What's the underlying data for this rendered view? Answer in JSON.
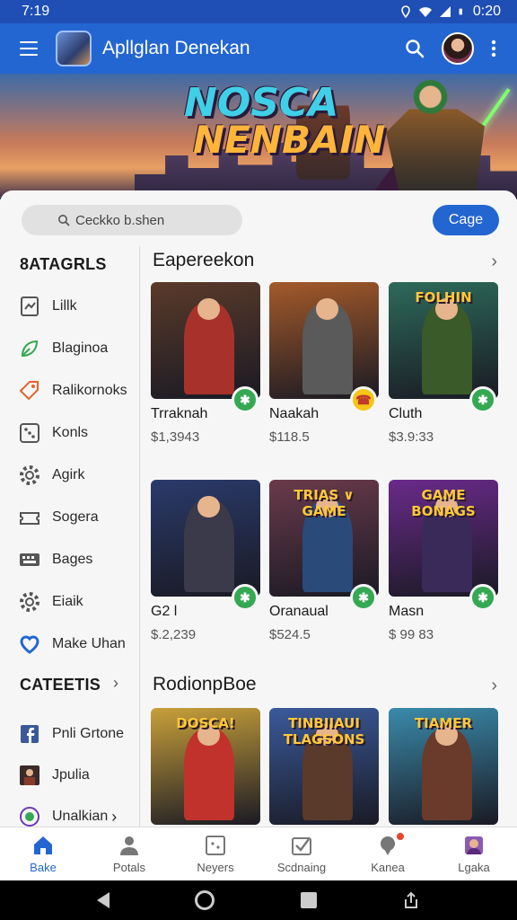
{
  "status_bar": {
    "time": "7:19",
    "clock_right": "0:20",
    "icons": [
      "location-icon",
      "wifi-icon",
      "signal-icon",
      "battery-icon"
    ]
  },
  "app_bar": {
    "title": "Apllglan Denekan",
    "icons": [
      "menu-icon",
      "search-icon",
      "more-vert-icon"
    ]
  },
  "banner": {
    "title_line1": "NOSCA",
    "title_line2": "NENBAIN"
  },
  "search": {
    "placeholder": "Ceckko b.shen",
    "button_label": "Cagе"
  },
  "sidebar": {
    "heading": "8ATAGRLS",
    "items": [
      {
        "label": "Lillk",
        "icon": "chart-doc-icon",
        "color": "#555555"
      },
      {
        "label": "Blaginoa",
        "icon": "leaf-icon",
        "color": "#34a853"
      },
      {
        "label": "Ralikornoks",
        "icon": "tag-icon",
        "color": "#e8632c"
      },
      {
        "label": "Konls",
        "icon": "dice-icon",
        "color": "#555555"
      },
      {
        "label": "Agirk",
        "icon": "gear-icon",
        "color": "#555555"
      },
      {
        "label": "Sogera",
        "icon": "ticket-icon",
        "color": "#555555"
      },
      {
        "label": "Bages",
        "icon": "keyboard-icon",
        "color": "#555555"
      },
      {
        "label": "Eiaik",
        "icon": "gear-icon",
        "color": "#555555"
      },
      {
        "label": "Make Uhan",
        "icon": "heart-icon",
        "color": "#2366d1"
      }
    ],
    "heading2": "CATEETIS",
    "items2": [
      {
        "label": "Pnli Grtone",
        "icon": "facebook-icon",
        "color": "#3b5998"
      },
      {
        "label": "Jpulia",
        "icon": "game-thumb-icon",
        "color": "#8a3a2a"
      },
      {
        "label": "Unalkian",
        "icon": "app-badge-icon",
        "color": "#6a3ab5"
      }
    ]
  },
  "sections": [
    {
      "title": "Eapereekon",
      "cards": [
        {
          "name": "Trraknah",
          "price": "$1,3943",
          "badge": "✱",
          "badge_style": "green",
          "bg": "#5a3a2a",
          "fig": "#a8322b"
        },
        {
          "name": "Naakah",
          "price": "$118.5",
          "badge": "☎",
          "badge_style": "yellow",
          "bg": "#a45a2a",
          "fig": "#5a5a5a"
        },
        {
          "name": "Cluth",
          "price": "$3.9:33",
          "badge": "✱",
          "badge_style": "green",
          "bg": "#2d6a5a",
          "fig": "#3a5a2a",
          "word": "FOLHIN"
        }
      ]
    },
    {
      "cards": [
        {
          "name": "G2 l",
          "price": "$.2,239",
          "badge": "✱",
          "badge_style": "green",
          "bg": "#2a3a6a",
          "fig": "#3a3a4a"
        },
        {
          "name": "Oranaual",
          "price": "$524.5",
          "badge": "✱",
          "badge_style": "green",
          "bg": "#6a3a4a",
          "fig": "#2a4a7a",
          "word": "TRIAS ∨ GAME"
        },
        {
          "name": "Masn",
          "price": "$ 99 83",
          "badge": "✱",
          "badge_style": "green",
          "bg": "#6a2a8a",
          "fig": "#3a2a5a",
          "word": "GAME BONAGS"
        }
      ]
    },
    {
      "title": "RodionpBoe",
      "cards": [
        {
          "bg": "#c8a03a",
          "fig": "#c0322b",
          "word": "DOSCA!"
        },
        {
          "bg": "#3a5a9a",
          "fig": "#5a3a2a",
          "word": "TINBIIAUI TLAGSONS"
        },
        {
          "bg": "#3a8aaa",
          "fig": "#6a3a2a",
          "word": "TIAMER"
        }
      ]
    }
  ],
  "bottom_nav": [
    {
      "label": "Bake",
      "icon": "home-icon",
      "active": true
    },
    {
      "label": "Potals",
      "icon": "person-icon"
    },
    {
      "label": "Neyers",
      "icon": "dice-box-icon"
    },
    {
      "label": "Scdnaing",
      "icon": "check-box-icon"
    },
    {
      "label": "Kanea",
      "icon": "chat-pin-icon",
      "dot": true
    },
    {
      "label": "Lgaka",
      "icon": "profile-thumb-icon"
    }
  ],
  "colors": {
    "primary": "#2366d1",
    "statusbar": "#1f4fb5",
    "accent_green": "#34a853"
  }
}
